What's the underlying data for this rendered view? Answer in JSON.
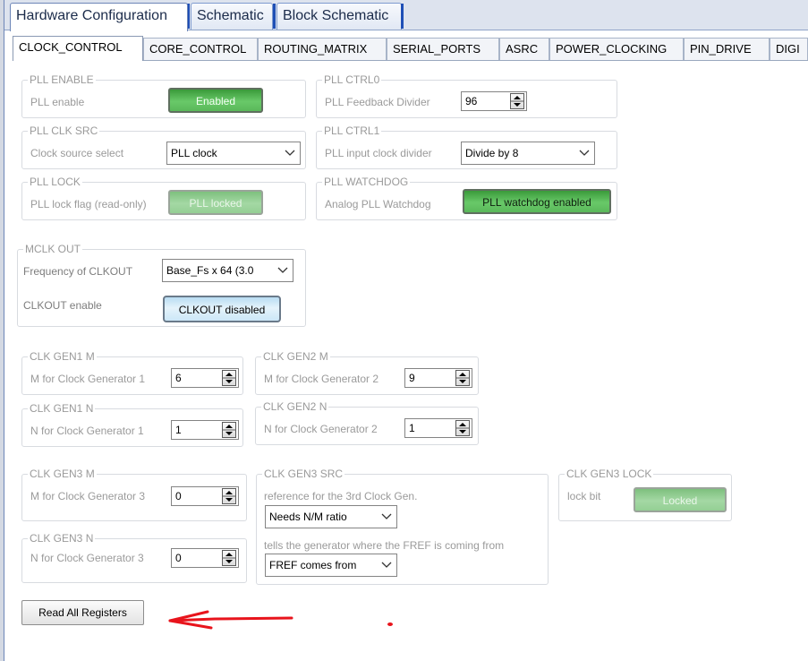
{
  "main_tabs": [
    "Hardware Configuration",
    "Schematic",
    "Block Schematic"
  ],
  "sub_tabs": [
    "CLOCK_CONTROL",
    "CORE_CONTROL",
    "ROUTING_MATRIX",
    "SERIAL_PORTS",
    "ASRC",
    "POWER_CLOCKING",
    "PIN_DRIVE",
    "DIGI"
  ],
  "groups": {
    "pll_enable": {
      "title": "PLL ENABLE",
      "label": "PLL enable",
      "button": "Enabled"
    },
    "pll_ctrl0": {
      "title": "PLL CTRL0",
      "label": "PLL Feedback Divider",
      "value": "96"
    },
    "pll_clk_src": {
      "title": "PLL CLK SRC",
      "label": "Clock source select",
      "value": "PLL clock"
    },
    "pll_ctrl1": {
      "title": "PLL CTRL1",
      "label": "PLL input clock divider",
      "value": "Divide by 8"
    },
    "pll_lock": {
      "title": "PLL LOCK",
      "label": "PLL lock flag (read-only)",
      "button": "PLL locked"
    },
    "pll_watchdog": {
      "title": "PLL WATCHDOG",
      "label": "Analog PLL Watchdog",
      "button": "PLL watchdog enabled"
    },
    "mclk_out": {
      "title": "MCLK OUT",
      "freq_label": "Frequency of CLKOUT",
      "freq_value": "Base_Fs x 64 (3.0",
      "enable_label": "CLKOUT enable",
      "enable_button": "CLKOUT disabled"
    },
    "clk_gen1_m": {
      "title": "CLK GEN1 M",
      "label": "M for Clock Generator 1",
      "value": "6"
    },
    "clk_gen2_m": {
      "title": "CLK GEN2 M",
      "label": "M for Clock Generator 2",
      "value": "9"
    },
    "clk_gen1_n": {
      "title": "CLK GEN1 N",
      "label": "N for Clock Generator 1",
      "value": "1"
    },
    "clk_gen2_n": {
      "title": "CLK GEN2 N",
      "label": "N for Clock Generator 2",
      "value": "1"
    },
    "clk_gen3_m": {
      "title": "CLK GEN3 M",
      "label": "M for Clock Generator 3",
      "value": "0"
    },
    "clk_gen3_src": {
      "title": "CLK GEN3 SRC",
      "label1": "reference for the 3rd Clock Gen.",
      "value1": "Needs N/M ratio",
      "label2": "tells the generator where the FREF is coming from",
      "value2": "FREF comes from"
    },
    "clk_gen3_lock": {
      "title": "CLK GEN3 LOCK",
      "label": "lock bit",
      "button": "Locked"
    },
    "clk_gen3_n": {
      "title": "CLK GEN3 N",
      "label": "N for Clock Generator 3",
      "value": "0"
    }
  },
  "read_all_button": "Read All Registers",
  "colors": {
    "annotation": "#e8141c",
    "accent_blue": "#1f4fb6",
    "button_green": "#5ab85a"
  }
}
